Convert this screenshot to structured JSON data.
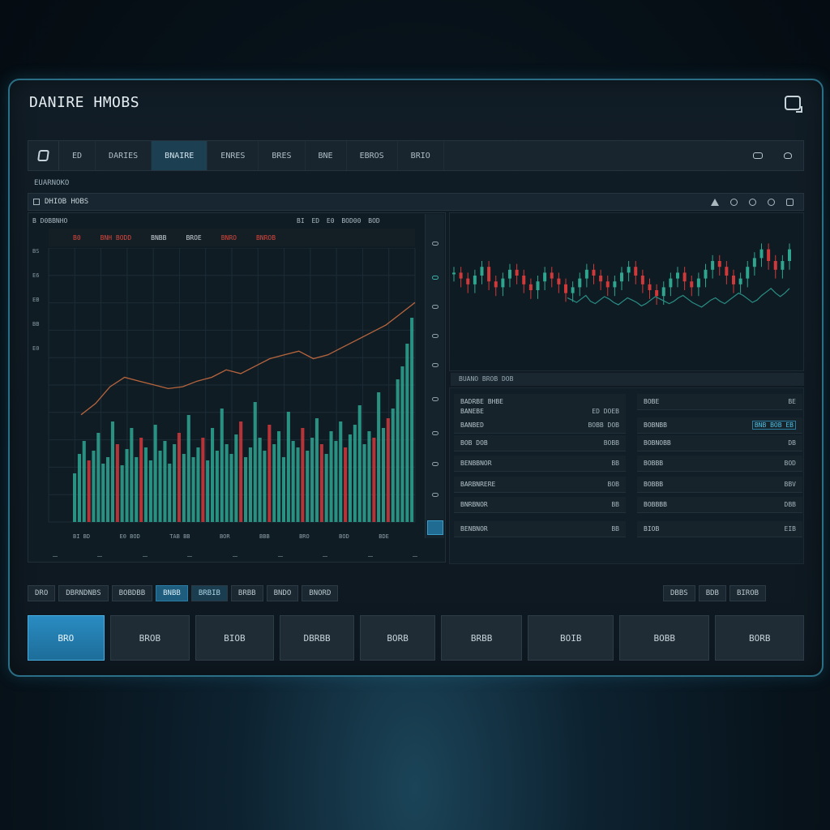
{
  "app": {
    "title": "DANIRE HMOBS"
  },
  "nav": {
    "items": [
      "ED",
      "DARIES",
      "BNAIRE",
      "ENRES",
      "BRES",
      "BNE",
      "EBROS",
      "BRIO"
    ],
    "active_index": 2
  },
  "section_label": "EUARNOKO",
  "subheader": {
    "label": "DHIOB HOBS"
  },
  "left_chart": {
    "header_left": "B  D0BBNHO",
    "header_right": "BI  ED  E0  BOD00 BOD",
    "legend": [
      {
        "label": "B0",
        "color": "#d9473d"
      },
      {
        "label": "BNH BODD",
        "color": "#d9473d"
      },
      {
        "label": "BNBB",
        "color": "#c9d3d8"
      },
      {
        "label": "BROE",
        "color": "#c9d3d8"
      },
      {
        "label": "BNRO",
        "color": "#d9473d"
      },
      {
        "label": "BNROB",
        "color": "#d9473d"
      }
    ],
    "footer": [
      "BI BD",
      "E0 BOD",
      "TAB BB",
      "BOR",
      "BBB",
      "BRO",
      "BOD",
      "BDE"
    ],
    "side_ticks": [
      "BS",
      "E6",
      "EB",
      "BB",
      "E0"
    ]
  },
  "orders": {
    "title": "BUANO BROB DOB",
    "left_rows": [
      {
        "label": "BADRBE  BHBE",
        "value": ""
      },
      {
        "label": "BANEBE",
        "value": "ED  DOEB"
      },
      {
        "label": "BANBED",
        "value": "BOBB  DOB"
      },
      {
        "label": "BOB DOB",
        "value": "BOBB"
      },
      {
        "label": "BENBBNOR",
        "value": "BB"
      },
      {
        "label": "BARBNRERE",
        "value": "BOB"
      },
      {
        "label": "BNRBNOR",
        "value": "BB"
      },
      {
        "label": "BENBNOR",
        "value": "BB"
      }
    ],
    "right_rows": [
      {
        "label": "BOBE",
        "value": "BE"
      },
      {
        "label": "BOBNBB",
        "value": "BNB  BOB  EB"
      },
      {
        "label": "BOBNOBB",
        "value": "DB"
      },
      {
        "label": "BOBBB",
        "value": "BOD"
      },
      {
        "label": "BOBBB",
        "value": "BBV"
      },
      {
        "label": "BOBBBB",
        "value": "DBB"
      },
      {
        "label": "BIOB",
        "value": "EIB"
      }
    ]
  },
  "toolbar_left": [
    "DRO",
    "DBRNDNBS",
    "BOBDBB",
    "BNBB",
    "BRBIB",
    "BRBB",
    "BNDO",
    "BNORD"
  ],
  "toolbar_left_active": 3,
  "toolbar_left_alt": 4,
  "toolbar_right": [
    "DBBS",
    "BDB",
    "BIROB"
  ],
  "big_buttons": [
    "BRO",
    "BROB",
    "BIOB",
    "DBRBB",
    "BORB",
    "BRBB",
    "BOIB",
    "BOBB",
    "BORB"
  ],
  "colors": {
    "accent": "#2a8cc2",
    "up": "#2fa58f",
    "down": "#d0393a",
    "line": "#b7653d"
  },
  "chart_data": [
    {
      "type": "bar",
      "series": [
        {
          "name": "volume",
          "values": [
            30,
            42,
            50,
            38,
            44,
            55,
            36,
            40,
            62,
            48,
            35,
            45,
            58,
            40,
            52,
            46,
            38,
            60,
            44,
            50,
            36,
            48,
            55,
            42,
            66,
            40,
            46,
            52,
            38,
            58,
            44,
            70,
            48,
            42,
            54,
            62,
            40,
            46,
            74,
            52,
            44,
            60,
            48,
            56,
            40,
            68,
            50,
            46,
            58,
            44,
            52,
            64,
            48,
            42,
            56,
            50,
            62,
            46,
            54,
            60,
            72,
            48,
            56,
            52,
            80,
            58,
            64,
            70,
            88,
            96,
            110,
            126
          ]
        }
      ],
      "overlay_line": [
        40,
        46,
        55,
        60,
        58,
        56,
        54,
        55,
        58,
        60,
        64,
        62,
        66,
        70,
        72,
        74,
        70,
        72,
        76,
        80,
        84,
        88,
        94,
        100
      ]
    },
    {
      "type": "line",
      "series": [
        {
          "name": "price",
          "values": [
            62,
            58,
            54,
            60,
            66,
            56,
            52,
            58,
            64,
            60,
            54,
            50,
            56,
            62,
            58,
            54,
            48,
            52,
            58,
            64,
            60,
            56,
            52,
            56,
            62,
            66,
            60,
            54,
            50,
            46,
            52,
            58,
            62,
            56,
            52,
            58,
            64,
            70,
            66,
            60,
            54,
            58,
            66,
            72,
            78,
            70,
            64,
            70,
            78
          ]
        }
      ]
    }
  ]
}
